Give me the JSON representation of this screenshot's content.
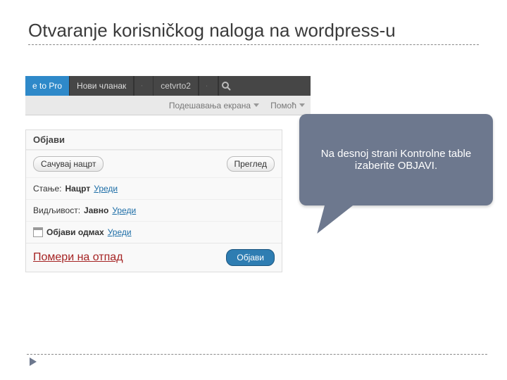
{
  "slide": {
    "title": "Otvaranje korisničkog naloga na wordpress-u"
  },
  "adminbar": {
    "upgrade": "e to Pro",
    "new_post": "Нови чланак",
    "site_name": "cetvrto2"
  },
  "subbar": {
    "screen_options": "Подешавања екрана",
    "help": "Помоћ"
  },
  "panel": {
    "header": "Објави",
    "save_draft": "Сачувај нацрт",
    "preview": "Преглед",
    "status_label": "Стање:",
    "status_value": "Нацрт",
    "edit": "Уреди",
    "visibility_label": "Видљивост:",
    "visibility_value": "Јавно",
    "publish_now": "Објави одмах",
    "move_to_trash": "Помери на отпад",
    "publish": "Објави"
  },
  "callout": {
    "text": "Na desnoj strani Kontrolne table izaberite OBJAVI."
  }
}
